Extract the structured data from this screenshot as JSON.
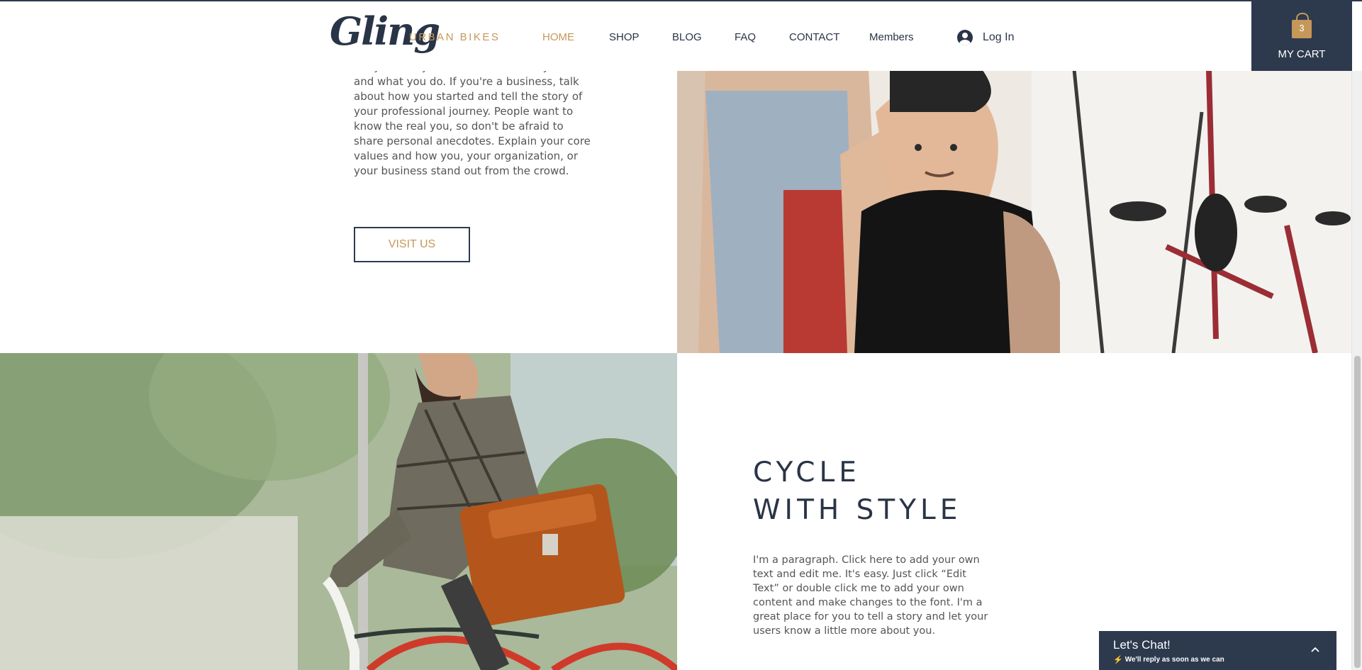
{
  "header": {
    "logo_script": "Gling",
    "logo_subtitle": "URBAN BIKES",
    "nav": [
      {
        "label": "HOME",
        "active": true
      },
      {
        "label": "SHOP",
        "active": false
      },
      {
        "label": "BLOG",
        "active": false
      },
      {
        "label": "FAQ",
        "active": false
      },
      {
        "label": "CONTACT",
        "active": false
      },
      {
        "label": "Members",
        "active": false
      }
    ],
    "login_label": "Log In",
    "cart": {
      "count": "3",
      "label": "MY CART"
    }
  },
  "about": {
    "text": "tell your story and to describe who you are and what you do. If you're a business, talk about how you started and tell the story of your professional journey. People want to know the real you, so don't be afraid to share personal anecdotes. Explain your core values and how you, your organization, or your business stand out from the crowd.",
    "button_label": "VISIT US"
  },
  "feature": {
    "heading_line1": "CYCLE",
    "heading_line2": "WITH STYLE",
    "paragraph": "I'm a paragraph. Click here to add your own text and edit me. It's easy. Just click “Edit Text” or double click me to add your own content and make changes to the font. I'm a great place for you to tell a story and let your users know a little more about you."
  },
  "chat": {
    "title": "Let's Chat!",
    "subtitle": "We'll reply as soon as we can"
  },
  "colors": {
    "navy": "#2d3a4e",
    "gold": "#c5985a",
    "text_gray": "#555555"
  }
}
